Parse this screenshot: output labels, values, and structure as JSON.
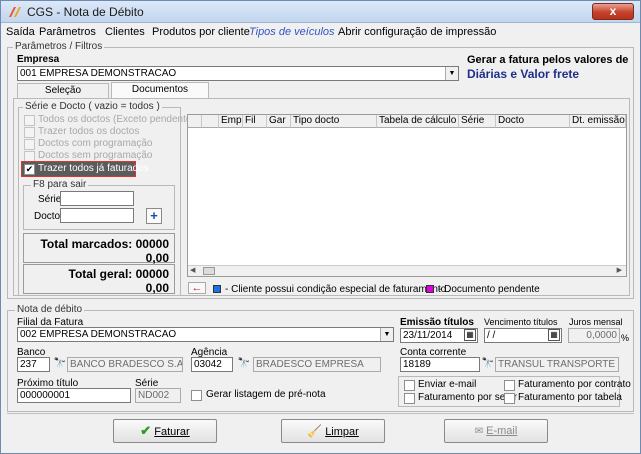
{
  "window": {
    "title": "CGS - Nota de Débito",
    "close": "x"
  },
  "menu": {
    "saida": "Saída",
    "parametros": "Parâmetros",
    "clientes": "Clientes",
    "produtos": "Produtos por cliente",
    "tipos": "Tipos de veículos",
    "abrir": "Abrir configuração de impressão"
  },
  "params": {
    "group_label": "Parâmetros / Filtros",
    "empresa_label": "Empresa",
    "empresa_value": "001 EMPRESA DEMONSTRACAO",
    "gerar_label": "Gerar a fatura pelos valores de",
    "gerar_value": "Diárias e Valor frete"
  },
  "tabs": {
    "selecao": "Seleção",
    "documentos": "Documentos"
  },
  "serie": {
    "group_label": "Série e Docto  ( vazio = todos )",
    "options": [
      {
        "label": "Todos os doctos (Exceto pendentes)",
        "checked": false,
        "disabled": true
      },
      {
        "label": "Trazer todos os doctos",
        "checked": false,
        "disabled": true
      },
      {
        "label": "Doctos com programação",
        "checked": false,
        "disabled": true
      },
      {
        "label": "Doctos sem programação",
        "checked": false,
        "disabled": true
      },
      {
        "label": "Trazer todos já faturados",
        "checked": true,
        "disabled": false
      }
    ]
  },
  "f8": {
    "group_label": "F8 para sair",
    "serie_label": "Série",
    "docto_label": "Docto",
    "serie_value": "",
    "docto_value": "",
    "add": "+"
  },
  "totals": {
    "marcados_label": "Total marcados: 00000",
    "marcados_value": "0,00",
    "geral_label": "Total geral: 00000",
    "geral_value": "0,00"
  },
  "grid": {
    "columns": [
      "",
      "Emp",
      "Fil",
      "Gar",
      "Tipo docto",
      "Tabela de cálculo",
      "Série",
      "Docto",
      "Dt. emissão"
    ]
  },
  "legend": {
    "item1": "- Cliente possui condição especial de faturamento",
    "item2": "- Documento pendente",
    "color1": "#1a73e8",
    "color2": "#e000e0"
  },
  "nota": {
    "group_label": "Nota de débito",
    "filial_label": "Filial da Fatura",
    "filial_value": "002 EMPRESA DEMONSTRACAO",
    "emissao_label": "Emissão títulos",
    "emissao_value": "23/11/2014",
    "vencimento_label": "Vencimento títulos",
    "vencimento_value": " / /",
    "juros_label": "Juros mensal",
    "juros_value": "0,0000",
    "juros_unit": "%",
    "banco_label": "Banco",
    "banco_code": "237",
    "banco_name": "BANCO BRADESCO S.A.",
    "agencia_label": "Agência",
    "agencia_code": "03042",
    "agencia_name": "BRADESCO EMPRESA",
    "conta_label": "Conta corrente",
    "conta_code": "18189",
    "conta_name": "TRANSUL TRANSPORTE LTI",
    "proximo_label": "Próximo título",
    "proximo_value": "000000001",
    "serie_label": "Série",
    "serie_value": "ND002",
    "gerar_listagem": "Gerar listagem de pré-nota",
    "enviar_email": "Enviar e-mail",
    "fat_setor": "Faturamento por setor",
    "fat_contrato": "Faturamento por contrato",
    "fat_tabela": "Faturamento por tabela"
  },
  "buttons": {
    "faturar": "Faturar",
    "limpar": "Limpar",
    "email": "E-mail"
  }
}
